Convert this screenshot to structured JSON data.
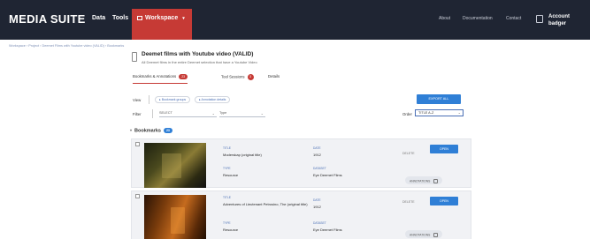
{
  "app": {
    "logo": "MEDIA SUITE",
    "nav": [
      "Data",
      "Tools"
    ],
    "workspace_tab": "Workspace",
    "right_links": [
      "About",
      "Documentation",
      "Contact"
    ],
    "account_label": "Account",
    "account_name": "badger"
  },
  "breadcrumb": "Workspace  ›  Project  ›  Deemet Films with Youtube video (VALID)  ›  Bookmarks",
  "header": {
    "title": "Deemet films with Youtube video (VALID)",
    "subtitle": "All Deemet films in the entire Deemet selection that have a Youtube Video"
  },
  "tabs": [
    {
      "label": "Bookmarks & Annotations",
      "badge": "23"
    },
    {
      "label": "Tool Sessions",
      "badge": "3"
    },
    {
      "label": "Details",
      "badge": ""
    }
  ],
  "toolbar": {
    "view_label": "View",
    "chip1": "Bookmark groups",
    "chip2": "Annotation details",
    "export_label": "EXPORT ALL",
    "filter_label": "Filter",
    "filter_select": "SELECT",
    "type_select": "Type",
    "order_label": "Order",
    "order_value": "TITLE A-Z"
  },
  "bookmarks": {
    "heading": "Bookmarks",
    "count": "23"
  },
  "cards": [
    {
      "title_key": "TITLE",
      "title": "Moderskap (original title)",
      "date_key": "DATE",
      "date": "1912",
      "type_key": "TYPE",
      "type": "Resource",
      "dataset_key": "DATASET",
      "dataset": "Eye Deemet Films",
      "delete_label": "DELETE",
      "open_label": "OPEN",
      "annotations_label": "ANNOTATIONS"
    },
    {
      "title_key": "TITLE",
      "title": "Adventures of Lieutenant Petrosino, The (original title)",
      "date_key": "DATE",
      "date": "1912",
      "type_key": "TYPE",
      "type": "Resource",
      "dataset_key": "DATASET",
      "dataset": "Eye Deemet Films",
      "delete_label": "DELETE",
      "open_label": "OPEN",
      "annotations_label": "ANNOTATIONS"
    }
  ],
  "colors": {
    "topbar": "#1f2533",
    "accent_red": "#c63a35",
    "accent_blue": "#2f7fd6"
  }
}
